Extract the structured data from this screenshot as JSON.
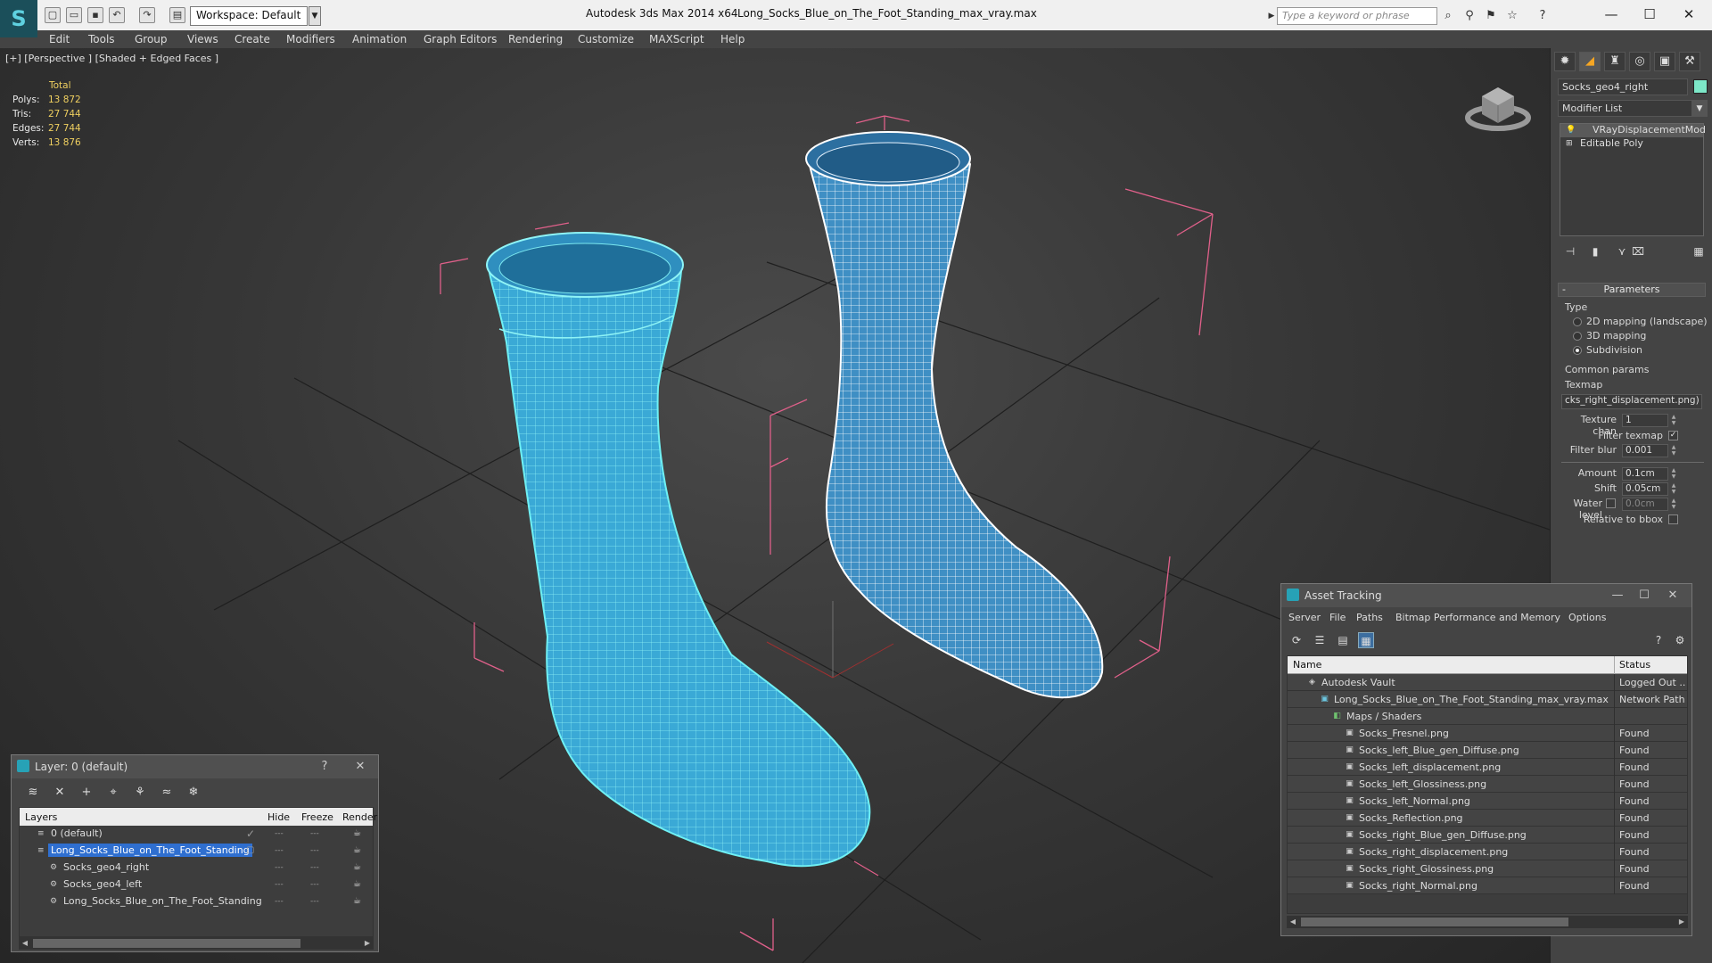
{
  "titlebar": {
    "workspace": "Workspace: Default",
    "app_title": "Autodesk 3ds Max  2014 x64",
    "document": "Long_Socks_Blue_on_The_Foot_Standing_max_vray.max",
    "search_placeholder": "Type a keyword or phrase"
  },
  "menu": [
    "Edit",
    "Tools",
    "Group",
    "Views",
    "Create",
    "Modifiers",
    "Animation",
    "Graph Editors",
    "Rendering",
    "Customize",
    "MAXScript",
    "Help"
  ],
  "viewport": {
    "label": "[+] [Perspective ] [Shaded + Edged Faces ]",
    "stats": {
      "header": "Total",
      "rows": [
        {
          "label": "Polys:",
          "value": "13 872"
        },
        {
          "label": "Tris:",
          "value": "27 744"
        },
        {
          "label": "Edges:",
          "value": "27 744"
        },
        {
          "label": "Verts:",
          "value": "13 876"
        }
      ]
    }
  },
  "command_panel": {
    "object_name": "Socks_geo4_right",
    "object_color": "#7de8c8",
    "modifier_list": "Modifier List",
    "stack": [
      "VRayDisplacementMod",
      "Editable Poly"
    ],
    "parameters_title": "Parameters",
    "type_label": "Type",
    "type_options": [
      {
        "label": "2D mapping (landscape)",
        "selected": false
      },
      {
        "label": "3D mapping",
        "selected": false
      },
      {
        "label": "Subdivision",
        "selected": true
      }
    ],
    "common_params": "Common params",
    "texmap_label": "Texmap",
    "texmap_value": "cks_right_displacement.png)",
    "texture_chan_label": "Texture chan",
    "texture_chan": "1",
    "filter_texmap_label": "Filter texmap",
    "filter_blur_label": "Filter blur",
    "filter_blur": "0.001",
    "amount_label": "Amount",
    "amount": "0.1cm",
    "shift_label": "Shift",
    "shift": "0.05cm",
    "water_level_label": "Water level",
    "water_level": "0.0cm",
    "relative_bbox_label": "Relative to bbox"
  },
  "asset_tracking": {
    "title": "Asset Tracking",
    "menu": [
      "Server",
      "File",
      "Paths",
      "Bitmap Performance and Memory",
      "Options"
    ],
    "col_name": "Name",
    "col_status": "Status",
    "rows": [
      {
        "name": "Autodesk Vault",
        "status": "Logged Out ..",
        "indent": 1,
        "icon": "vault-icon"
      },
      {
        "name": "Long_Socks_Blue_on_The_Foot_Standing_max_vray.max",
        "status": "Network Path",
        "indent": 2,
        "icon": "max-file-icon"
      },
      {
        "name": "Maps / Shaders",
        "status": "",
        "indent": 3,
        "icon": "maps-icon"
      },
      {
        "name": "Socks_Fresnel.png",
        "status": "Found",
        "indent": 4,
        "icon": "bitmap-icon"
      },
      {
        "name": "Socks_left_Blue_gen_Diffuse.png",
        "status": "Found",
        "indent": 4,
        "icon": "bitmap-icon"
      },
      {
        "name": "Socks_left_displacement.png",
        "status": "Found",
        "indent": 4,
        "icon": "bitmap-icon"
      },
      {
        "name": "Socks_left_Glossiness.png",
        "status": "Found",
        "indent": 4,
        "icon": "bitmap-icon"
      },
      {
        "name": "Socks_left_Normal.png",
        "status": "Found",
        "indent": 4,
        "icon": "bitmap-icon"
      },
      {
        "name": "Socks_Reflection.png",
        "status": "Found",
        "indent": 4,
        "icon": "bitmap-icon"
      },
      {
        "name": "Socks_right_Blue_gen_Diffuse.png",
        "status": "Found",
        "indent": 4,
        "icon": "bitmap-icon"
      },
      {
        "name": "Socks_right_displacement.png",
        "status": "Found",
        "indent": 4,
        "icon": "bitmap-icon"
      },
      {
        "name": "Socks_right_Glossiness.png",
        "status": "Found",
        "indent": 4,
        "icon": "bitmap-icon"
      },
      {
        "name": "Socks_right_Normal.png",
        "status": "Found",
        "indent": 4,
        "icon": "bitmap-icon"
      }
    ]
  },
  "layer_window": {
    "title": "Layer: 0 (default)",
    "col_layers": "Layers",
    "col_hide": "Hide",
    "col_freeze": "Freeze",
    "col_render": "Render",
    "rows": [
      {
        "name": "0 (default)",
        "indent": 1,
        "selected": false,
        "current": true
      },
      {
        "name": "Long_Socks_Blue_on_The_Foot_Standing",
        "indent": 1,
        "selected": true,
        "current": false
      },
      {
        "name": "Socks_geo4_right",
        "indent": 2,
        "selected": false,
        "current": false
      },
      {
        "name": "Socks_geo4_left",
        "indent": 2,
        "selected": false,
        "current": false
      },
      {
        "name": "Long_Socks_Blue_on_The_Foot_Standing",
        "indent": 2,
        "selected": false,
        "current": false
      }
    ]
  },
  "colors": {
    "sock_left": "#3aa9d6",
    "sock_right": "#3f8fc4",
    "bbox": "#e0608a",
    "accent": "#f6a623"
  }
}
